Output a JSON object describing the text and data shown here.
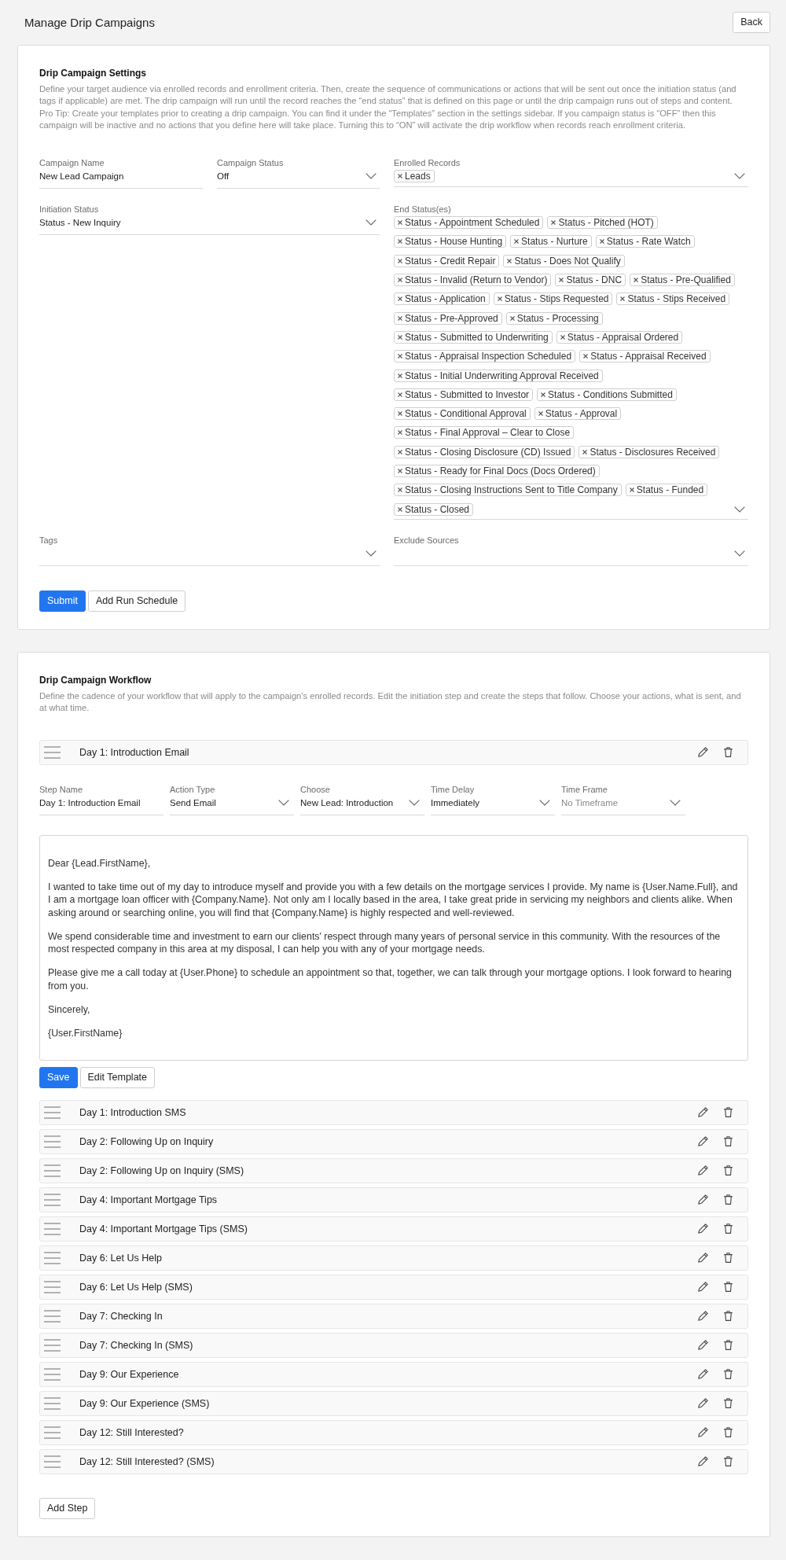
{
  "header": {
    "title": "Manage Drip Campaigns",
    "back_button": "Back"
  },
  "settings": {
    "title": "Drip Campaign Settings",
    "description": "Define your target audience via enrolled records and enrollment criteria. Then, create the sequence of communications or actions that will be sent out once the initiation status (and tags if applicable) are met. The drip campaign will run until the record reaches the “end status” that is defined on this page or until the drip campaign runs out of steps and content. Pro Tip: Create your templates prior to creating a drip campaign. You can find it under the “Templates” section in the settings sidebar. If you campaign status is “OFF” then this campaign will be inactive and no actions that you define here will take place. Turning this to “ON” will activate the drip workflow when records reach enrollment criteria.",
    "fields": [
      {
        "kind": "text",
        "label": "Campaign Name",
        "value": "New Lead Campaign"
      },
      {
        "kind": "select",
        "label": "Campaign Status",
        "value": "Off"
      },
      {
        "kind": "multiselect",
        "label": "Enrolled Records",
        "tags": [
          "Leads"
        ]
      },
      {
        "kind": "select",
        "label": "Initiation Status",
        "value": "Status - New Inquiry"
      },
      {
        "kind": "multiselect",
        "label": "End Status(es)",
        "tags": [
          "Status - Appointment Scheduled",
          "Status - Pitched (HOT)",
          "Status - House Hunting",
          "Status - Nurture",
          "Status - Rate Watch",
          "Status - Credit Repair",
          "Status - Does Not Qualify",
          "Status - Invalid (Return to Vendor)",
          "Status - DNC",
          "Status - Pre-Qualified",
          "Status - Application",
          "Status - Stips Requested",
          "Status - Stips Received",
          "Status - Pre-Approved",
          "Status - Processing",
          "Status - Submitted to Underwriting",
          "Status - Appraisal Ordered",
          "Status - Appraisal Inspection Scheduled",
          "Status - Appraisal Received",
          "Status - Initial Underwriting Approval Received",
          "Status - Submitted to Investor",
          "Status - Conditions Submitted",
          "Status - Conditional Approval",
          "Status - Approval",
          "Status - Final Approval – Clear to Close",
          "Status - Closing Disclosure (CD) Issued",
          "Status - Disclosures Received",
          "Status - Ready for Final Docs (Docs Ordered)",
          "Status - Closing Instructions Sent to Title Company",
          "Status - Funded",
          "Status - Closed"
        ]
      },
      {
        "kind": "select",
        "label": "Tags"
      },
      {
        "kind": "select",
        "label": "Exclude Sources"
      }
    ],
    "buttons": [
      {
        "label": "Submit",
        "kind": "primary"
      },
      {
        "label": "Add Run Schedule",
        "kind": "secondary"
      }
    ]
  },
  "workflow": {
    "title": "Drip Campaign Workflow",
    "description": "Define the cadence of your workflow that will apply to the campaign's enrolled records. Edit the initiation step and create the steps that follow. Choose your actions, what is sent, and at what time.",
    "steps": [
      {
        "title": "Day 1: Introduction Email",
        "editor": {
          "fields": [
            {
              "kind": "text",
              "label": "Step Name",
              "value": "Day 1: Introduction Email"
            },
            {
              "kind": "select",
              "label": "Action Type",
              "value": "Send Email"
            },
            {
              "kind": "select",
              "label": "Choose",
              "value": "New Lead: Introduction"
            },
            {
              "kind": "select",
              "label": "Time Delay",
              "value": "Immediately"
            },
            {
              "kind": "select",
              "label": "Time Frame",
              "placeholder": "No Timeframe"
            }
          ],
          "email_body": [
            "Dear {Lead.FirstName},",
            "I wanted to take time out of my day to introduce myself and provide you with a few details on the mortgage services I provide. My name is {User.Name.Full}, and I am a mortgage loan officer with {Company.Name}. Not only am I locally based in the area, I take great pride in servicing my neighbors and clients alike. When asking around or searching online, you will find that {Company.Name} is highly respected and well-reviewed.",
            "We spend considerable time and investment to earn our clients' respect through many years of personal service in this community. With the resources of the most respected company in this area at my disposal, I can help you with any of your mortgage needs.",
            "Please give me a call today at {User.Phone} to schedule an appointment so that, together, we can talk through your mortgage options. I look forward to hearing from you.",
            "Sincerely,",
            "{User.FirstName}"
          ],
          "buttons": [
            {
              "label": "Save",
              "kind": "primary"
            },
            {
              "label": "Edit Template",
              "kind": "secondary"
            }
          ]
        }
      },
      {
        "title": "Day 1: Introduction SMS"
      },
      {
        "title": "Day 2: Following Up on Inquiry"
      },
      {
        "title": "Day 2: Following Up on Inquiry (SMS)"
      },
      {
        "title": "Day 4: Important Mortgage Tips"
      },
      {
        "title": "Day 4: Important Mortgage Tips (SMS)"
      },
      {
        "title": "Day 6: Let Us Help"
      },
      {
        "title": "Day 6: Let Us Help (SMS)"
      },
      {
        "title": "Day 7: Checking In"
      },
      {
        "title": "Day 7: Checking In (SMS)"
      },
      {
        "title": "Day 9: Our Experience"
      },
      {
        "title": "Day 9: Our Experience (SMS)"
      },
      {
        "title": "Day 12: Still Interested?"
      },
      {
        "title": "Day 12: Still Interested? (SMS)"
      }
    ],
    "add_step_button": "Add Step"
  }
}
